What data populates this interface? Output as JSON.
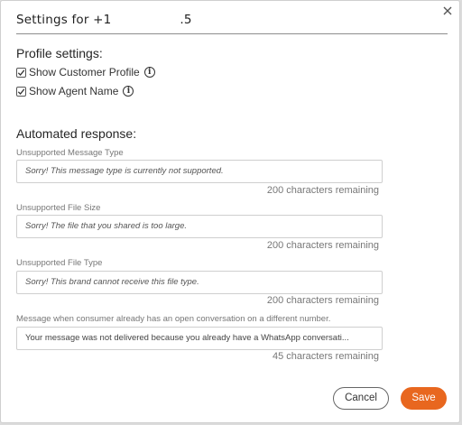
{
  "dialog": {
    "title_prefix": "Settings for +1",
    "title_suffix": ".5",
    "close_glyph": "×"
  },
  "profile": {
    "heading": "Profile settings:",
    "options": [
      {
        "label": "Show Customer Profile",
        "checked": true
      },
      {
        "label": "Show Agent Name",
        "checked": true
      }
    ]
  },
  "automated": {
    "heading": "Automated response:",
    "fields": [
      {
        "label": "Unsupported Message Type",
        "value": "Sorry! This message type is currently not supported.",
        "remaining": "200 characters remaining"
      },
      {
        "label": "Unsupported File Size",
        "value": "Sorry! The file that you shared is too large.",
        "remaining": "200 characters remaining"
      },
      {
        "label": "Unsupported File Type",
        "value": "Sorry! This brand cannot receive this file type.",
        "remaining": "200 characters remaining"
      },
      {
        "label": "Message when consumer already has an open conversation on a different number.",
        "value": "Your message was not delivered because you already have a WhatsApp conversati...",
        "remaining": "45 characters remaining"
      }
    ]
  },
  "buttons": {
    "cancel": "Cancel",
    "save": "Save"
  },
  "colors": {
    "accent": "#e8671f",
    "divider": "#8e8e8e"
  },
  "icons": {
    "close": "close-icon",
    "info": "info-icon",
    "checkbox": "checkbox-checked-icon"
  }
}
